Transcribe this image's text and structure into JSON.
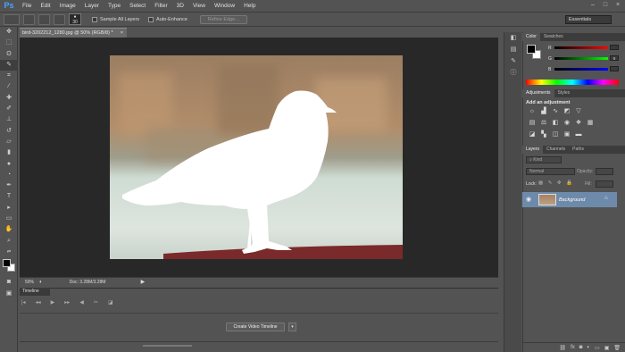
{
  "app": {
    "logo": "Ps"
  },
  "menu": [
    "File",
    "Edit",
    "Image",
    "Layer",
    "Type",
    "Select",
    "Filter",
    "3D",
    "View",
    "Window",
    "Help"
  ],
  "window_controls": [
    "–",
    "□",
    "×"
  ],
  "options": {
    "brush_size": "30",
    "sample_all_layers": "Sample All Layers",
    "auto_enhance": "Auto-Enhance",
    "refine_edge": "Refine Edge...",
    "workspace": "Essentials"
  },
  "document": {
    "tab_title": "bird-3202212_1280.jpg @ 50% (RGB/8) *",
    "close": "×",
    "zoom": "50%",
    "doc_size": "Doc: 3.28M/3.28M"
  },
  "timeline": {
    "tab": "Timeline",
    "create_button": "Create Video Timeline"
  },
  "color_panel": {
    "tabs": [
      "Color",
      "Swatches"
    ],
    "sliders": [
      {
        "label": "R",
        "value": "",
        "color": "#ff0000"
      },
      {
        "label": "G",
        "value": "0",
        "color": "#00ff00"
      },
      {
        "label": "B",
        "value": "",
        "color": "#0000ff"
      }
    ]
  },
  "adjustments_panel": {
    "tabs": [
      "Adjustments",
      "Styles"
    ],
    "title": "Add an adjustment"
  },
  "layers_panel": {
    "tabs": [
      "Layers",
      "Channels",
      "Paths"
    ],
    "filter": "Kind",
    "blend_mode": "Normal",
    "opacity_label": "Opacity:",
    "lock_label": "Lock:",
    "fill_label": "Fill:",
    "layer_name": "Background"
  }
}
